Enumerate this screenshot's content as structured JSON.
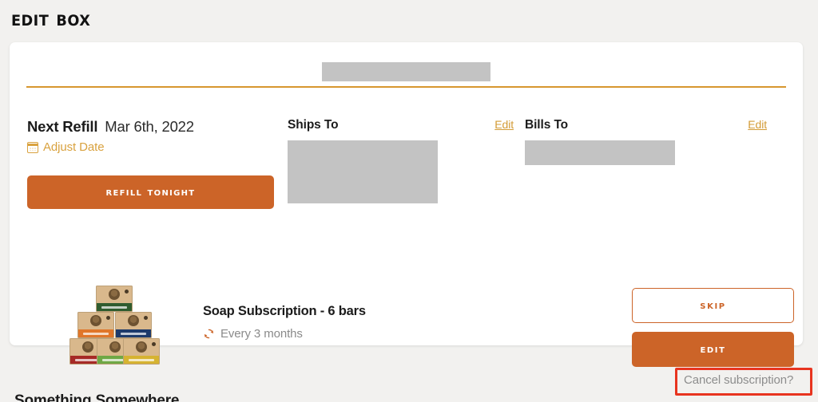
{
  "page": {
    "title": "Edit Box",
    "background_color": "#f2f1ef",
    "accent_orange": "#cc6428",
    "accent_gold": "#d39b36",
    "highlight_color": "#e8341f"
  },
  "card": {
    "top_redaction": "",
    "divider_color": "#d7972f"
  },
  "refill": {
    "label": "Next Refill",
    "date": "Mar 6th, 2022",
    "adjust_date_label": "Adjust Date",
    "calendar_icon": "calendar-icon",
    "refill_button_label": "Refill Tonight"
  },
  "ships_to": {
    "title": "Ships To",
    "edit_label": "Edit",
    "address_redacted": ""
  },
  "bills_to": {
    "title": "Bills To",
    "edit_label": "Edit",
    "address_redacted": ""
  },
  "product": {
    "title": "Soap Subscription - 6 bars",
    "frequency": "Every 3 months",
    "refresh_icon": "refresh-icon",
    "image_alt": "soap-boxes-pyramid",
    "box_colors": [
      "#2f5c2f",
      "#e0762a",
      "#1d3a6b",
      "#a62a26",
      "#6fa845",
      "#d6b331"
    ],
    "skip_button_label": "Skip",
    "edit_button_label": "Edit"
  },
  "footer": {
    "cancel_label": "Cancel subscription?",
    "cut_off_text": "Something Somewhere"
  }
}
